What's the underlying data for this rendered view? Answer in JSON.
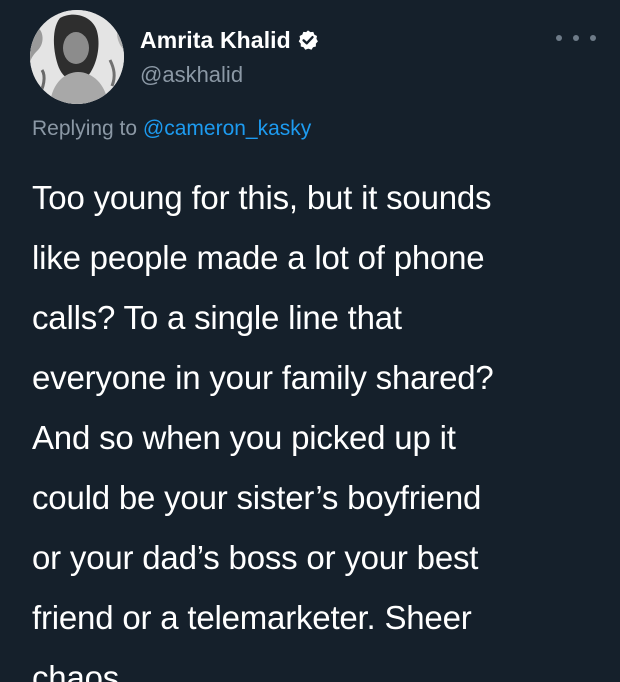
{
  "tweet": {
    "author": {
      "display_name": "Amrita Khalid",
      "handle": "@askhalid",
      "verified": true
    },
    "reply_prefix": "Replying to ",
    "reply_to": "@cameron_kasky",
    "body_lines": [
      "Too young for this, but it sounds",
      "like people made a lot of phone",
      "calls? To a single line that",
      "everyone in your family shared?",
      "And so when you picked up it",
      "could be your sister’s boyfriend",
      "or your dad’s boss or your best",
      "friend or a telemarketer. Sheer",
      "chaos."
    ]
  },
  "icons": {
    "verified": "verified-badge-icon",
    "more": "more-options-icon"
  },
  "colors": {
    "background": "#15202b",
    "primary_text": "#ffffff",
    "secondary_text": "#8b98a5",
    "link": "#1d9bf0"
  }
}
